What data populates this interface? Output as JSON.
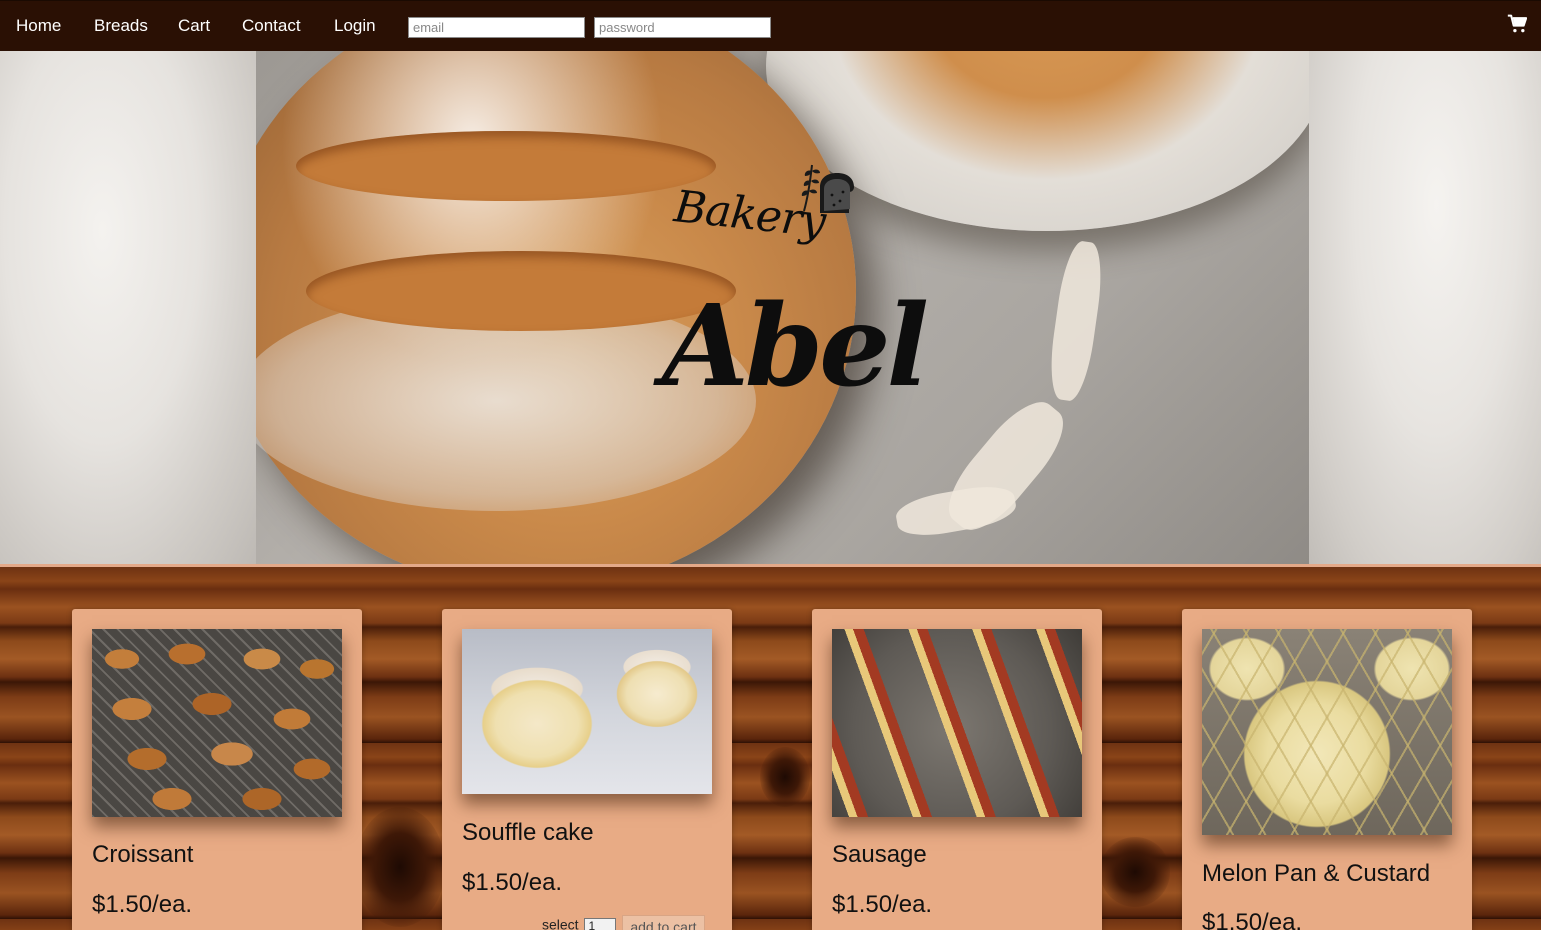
{
  "nav": {
    "links": [
      {
        "label": "Home"
      },
      {
        "label": "Breads"
      },
      {
        "label": "Cart"
      },
      {
        "label": "Contact"
      },
      {
        "label": "Login"
      }
    ],
    "email_placeholder": "email",
    "password_placeholder": "password",
    "cart_icon": "shopping-cart-icon"
  },
  "hero": {
    "logo_small": "Bakery",
    "logo_large": "Abel",
    "logo_icon": "bread-wheat-icon"
  },
  "products": [
    {
      "name": "Croissant",
      "price": "$1.50/ea."
    },
    {
      "name": "Souffle cake",
      "price": "$1.50/ea.",
      "select_label": "select",
      "qty": "1",
      "add_label": "add to cart"
    },
    {
      "name": "Sausage",
      "price": "$1.50/ea."
    },
    {
      "name": "Melon Pan & Custard",
      "price": "$1.50/ea."
    }
  ],
  "colors": {
    "nav_bg": "#2a1004",
    "card_bg": "#e8ab85",
    "text": "#111111"
  }
}
